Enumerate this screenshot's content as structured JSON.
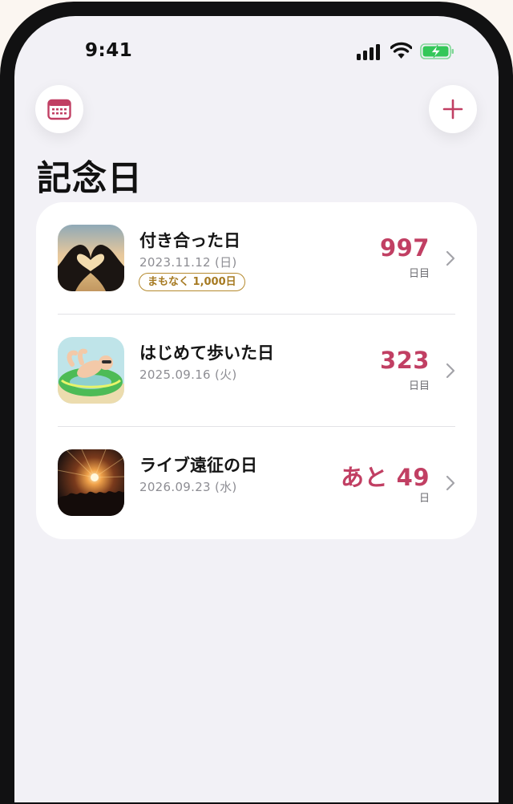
{
  "status_bar": {
    "time": "9:41"
  },
  "header": {
    "calendar_button_icon": "calendar-icon",
    "add_button_icon": "plus-icon",
    "title": "記念日"
  },
  "colors": {
    "accent": "#c13f63",
    "badge": "#b58a2e",
    "battery": "#34c759"
  },
  "anniversaries": [
    {
      "title": "付き合った日",
      "date": "2023.11.12 (日)",
      "badge": "まもなく 1,000日",
      "count": "997",
      "unit": "日目",
      "thumbnail": "heart-hands-photo"
    },
    {
      "title": "はじめて歩いた日",
      "date": "2025.09.16 (火)",
      "count": "323",
      "unit": "日目",
      "thumbnail": "baby-float-photo"
    },
    {
      "title": "ライブ遠征の日",
      "date": "2026.09.23 (水)",
      "count": "あと 49",
      "unit": "日",
      "thumbnail": "concert-photo"
    }
  ]
}
